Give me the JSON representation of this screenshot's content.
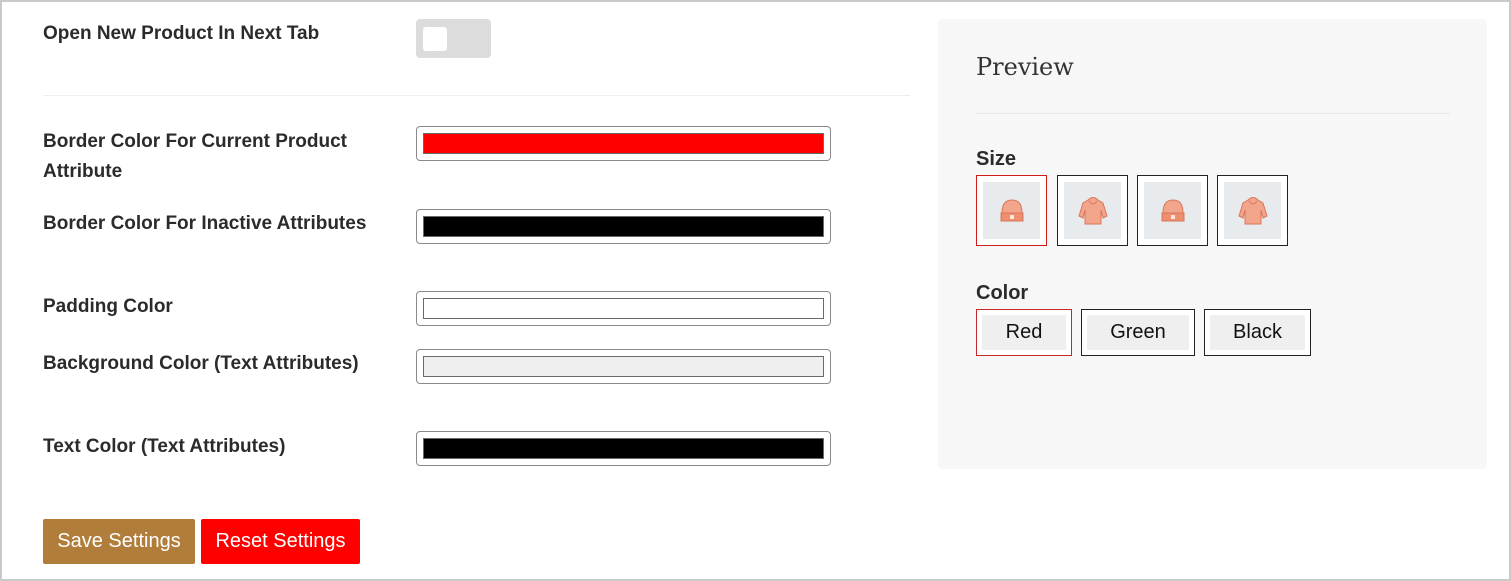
{
  "settings": {
    "open_new_tab": {
      "label": "Open New Product In Next Tab",
      "enabled": false
    },
    "fields": [
      {
        "label": "Border Color For Current Product Attribute",
        "color": "#ff0000"
      },
      {
        "label": "Border Color For Inactive Attributes",
        "color": "#000000"
      },
      {
        "label": "Padding Color",
        "color": "#ffffff"
      },
      {
        "label": "Background Color (Text Attributes)",
        "color": "#efefef"
      },
      {
        "label": "Text Color (Text Attributes)",
        "color": "#000000"
      }
    ]
  },
  "buttons": {
    "save": {
      "label": "Save Settings",
      "color": "#b07d3a"
    },
    "reset": {
      "label": "Reset Settings",
      "color": "#ff0000"
    }
  },
  "preview": {
    "title": "Preview",
    "size": {
      "label": "Size",
      "options": [
        {
          "icon": "beanie-icon",
          "active": true
        },
        {
          "icon": "hoodie-icon",
          "active": false
        },
        {
          "icon": "beanie-icon",
          "active": false
        },
        {
          "icon": "hoodie-icon",
          "active": false
        }
      ]
    },
    "color": {
      "label": "Color",
      "options": [
        {
          "label": "Red",
          "active": true
        },
        {
          "label": "Green",
          "active": false
        },
        {
          "label": "Black",
          "active": false
        }
      ]
    }
  }
}
